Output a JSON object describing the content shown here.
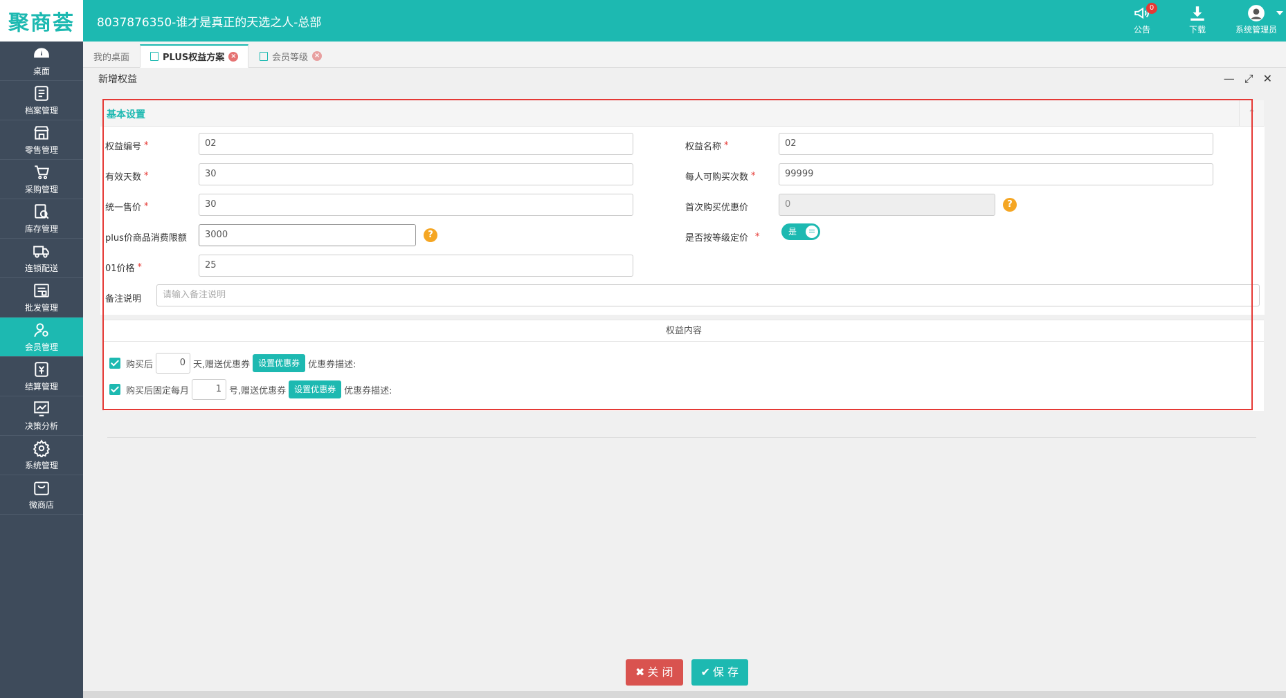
{
  "header": {
    "logo_text": "聚商荟",
    "title": "8037876350-谁才是真正的天选之人-总部",
    "actions": [
      {
        "label": "公告",
        "icon": "megaphone-icon",
        "badge": "0"
      },
      {
        "label": "下载",
        "icon": "download-icon"
      },
      {
        "label": "系统管理员",
        "icon": "avatar-icon"
      }
    ]
  },
  "sidebar": {
    "items": [
      {
        "label": "桌面",
        "icon": "dashboard-icon"
      },
      {
        "label": "档案管理",
        "icon": "file-icon"
      },
      {
        "label": "零售管理",
        "icon": "store-icon"
      },
      {
        "label": "采购管理",
        "icon": "cart-icon"
      },
      {
        "label": "库存管理",
        "icon": "inventory-icon"
      },
      {
        "label": "连锁配送",
        "icon": "truck-icon"
      },
      {
        "label": "批发管理",
        "icon": "wholesale-icon"
      },
      {
        "label": "会员管理",
        "icon": "member-icon",
        "active": true
      },
      {
        "label": "结算管理",
        "icon": "settlement-icon"
      },
      {
        "label": "决策分析",
        "icon": "chart-icon"
      },
      {
        "label": "系统管理",
        "icon": "gear-icon"
      },
      {
        "label": "微商店",
        "icon": "bag-icon"
      }
    ]
  },
  "tabs": [
    {
      "label": "我的桌面"
    },
    {
      "label": "PLUS权益方案",
      "active": true
    },
    {
      "label": "会员等级"
    }
  ],
  "panel": {
    "title": "新增权益"
  },
  "basic": {
    "section_title": "基本设置",
    "code_label": "权益编号",
    "code_value": "02",
    "name_label": "权益名称",
    "name_value": "02",
    "days_label": "有效天数",
    "days_value": "30",
    "times_label": "每人可购买次数",
    "times_value": "99999",
    "price_label": "统一售价",
    "price_value": "30",
    "first_label": "首次购买优惠价",
    "first_value": "0",
    "limit_label": "plus价商品消费限额",
    "limit_value": "3000",
    "level_label": "是否按等级定价",
    "toggle_label": "是",
    "p01_label": "01价格",
    "p01_value": "25",
    "remark_label": "备注说明",
    "remark_placeholder": "请输入备注说明"
  },
  "benefit": {
    "title": "权益内容",
    "row1_prefix": "购买后",
    "row1_value": "0",
    "row1_suffix": "天,赠送优惠券",
    "row2_prefix": "购买后固定每月",
    "row2_value": "1",
    "row2_suffix": "号,赠送优惠券",
    "coupon_btn": "设置优惠券",
    "coupon_desc": "优惠券描述:"
  },
  "footer": {
    "close_label": "关 闭",
    "save_label": "保 存"
  },
  "colors": {
    "brand": "#1db9b1",
    "sidebar": "#3e4b5b",
    "danger": "#d9534f",
    "help": "#f5a623"
  }
}
